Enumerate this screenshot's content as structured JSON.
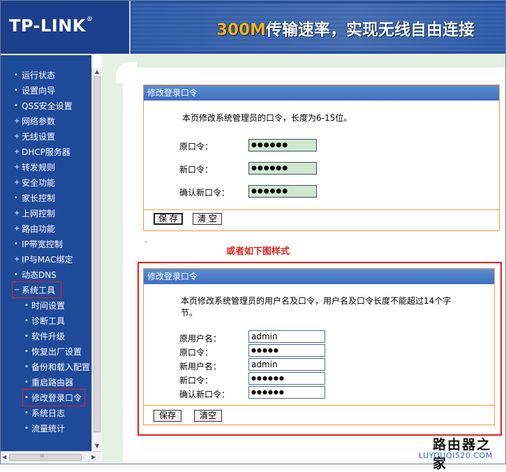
{
  "header": {
    "logo": "TP-LINK",
    "logo_mark": "®",
    "banner_highlight": "300M",
    "banner_text": "传输速率，实现无线自由连接"
  },
  "sidebar": {
    "items": [
      {
        "label": "运行状态",
        "bullet": "•"
      },
      {
        "label": "设置向导",
        "bullet": "•"
      },
      {
        "label": "QSS安全设置",
        "bullet": "•"
      },
      {
        "label": "网络参数",
        "bullet": "+"
      },
      {
        "label": "无线设置",
        "bullet": "+"
      },
      {
        "label": "DHCP服务器",
        "bullet": "+"
      },
      {
        "label": "转发规则",
        "bullet": "+"
      },
      {
        "label": "安全功能",
        "bullet": "+"
      },
      {
        "label": "家长控制",
        "bullet": "•"
      },
      {
        "label": "上网控制",
        "bullet": "+"
      },
      {
        "label": "路由功能",
        "bullet": "+"
      },
      {
        "label": "IP带宽控制",
        "bullet": "•"
      },
      {
        "label": "IP与MAC绑定",
        "bullet": "+"
      },
      {
        "label": "动态DNS",
        "bullet": "•"
      },
      {
        "label": "系统工具",
        "bullet": "−"
      }
    ],
    "subitems": [
      {
        "label": "时间设置"
      },
      {
        "label": "诊断工具"
      },
      {
        "label": "软件升级"
      },
      {
        "label": "恢复出厂设置"
      },
      {
        "label": "备份和载入配置"
      },
      {
        "label": "重启路由器"
      },
      {
        "label": "修改登录口令"
      },
      {
        "label": "系统日志"
      },
      {
        "label": "流量统计"
      }
    ],
    "sub_bullet": "•",
    "hscroll_grip": "III"
  },
  "panel1": {
    "title": "修改登录口令",
    "desc": "本页修改系统管理员的口令，长度为6-15位。",
    "fields": [
      {
        "label": "原口令：",
        "value": "●●●●●●"
      },
      {
        "label": "新口令：",
        "value": "●●●●●●"
      },
      {
        "label": "确认新口令：",
        "value": "●●●●●●"
      }
    ],
    "save": "保 存",
    "clear": "清 空"
  },
  "mark": "`",
  "note": "或者如下图样式",
  "panel2": {
    "title": "修改登录口令",
    "desc_line1": "本页修改系统管理员的用户名及口令，用户名及口令长度不能超过14个字",
    "desc_line2": "节。",
    "fields": [
      {
        "label": "原用户名：",
        "value": "admin"
      },
      {
        "label": "原口令：",
        "value": "●●●●●"
      },
      {
        "label": "新用户名：",
        "value": "admin"
      },
      {
        "label": "新口令：",
        "value": "●●●●●●"
      },
      {
        "label": "确认新口令：",
        "value": "●●●●●●"
      }
    ],
    "save": "保存",
    "clear": "清空"
  },
  "watermark": {
    "title": "路由器之家",
    "url": "LUYOUQI520.COM"
  },
  "colors": {
    "nav_bg": "#1f4a9a",
    "panel_border": "#e89c47",
    "highlight_red": "#e02020",
    "banner_accent": "#f2b21b"
  }
}
